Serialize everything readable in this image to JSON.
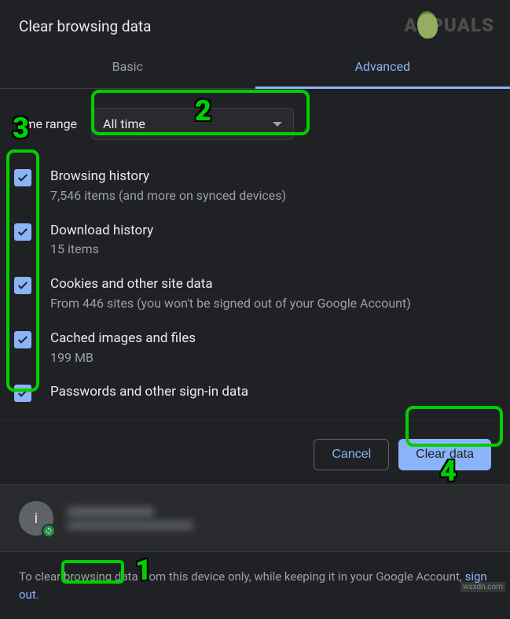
{
  "title": "Clear browsing data",
  "tabs": {
    "basic": "Basic",
    "advanced": "Advanced"
  },
  "timeRange": {
    "label": "Time range",
    "selected": "All time"
  },
  "items": [
    {
      "title": "Browsing history",
      "sub": "7,546 items (and more on synced devices)",
      "checked": true
    },
    {
      "title": "Download history",
      "sub": "15 items",
      "checked": true
    },
    {
      "title": "Cookies and other site data",
      "sub": "From 446 sites (you won't be signed out of your Google Account)",
      "checked": true
    },
    {
      "title": "Cached images and files",
      "sub": "199 MB",
      "checked": true
    },
    {
      "title": "Passwords and other sign-in data",
      "sub": "",
      "checked": true
    }
  ],
  "buttons": {
    "cancel": "Cancel",
    "clear": "Clear data"
  },
  "avatar_letter": "i",
  "footer": {
    "part1": "To clear browsing data from this device only, while keeping it in your Google Account, ",
    "link": "sign out",
    "part2": "."
  },
  "annotations": {
    "n1": "1",
    "n2": "2",
    "n3": "3",
    "n4": "4"
  },
  "watermark_site": "wsxdn.com",
  "watermark_brand": "A  PUALS"
}
